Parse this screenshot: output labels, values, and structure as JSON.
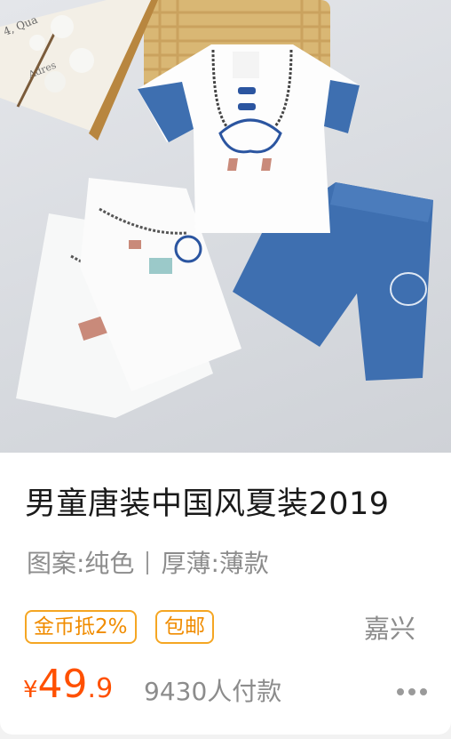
{
  "product": {
    "title": "男童唐装中国风夏装2019",
    "specs": [
      {
        "text": "图案:纯色"
      },
      {
        "text": "厚薄:薄款"
      }
    ],
    "badges": {
      "coin": "金币抵2%",
      "shipping": "包邮"
    },
    "location": "嘉兴",
    "price": {
      "currency": "¥",
      "integer": "49",
      "decimal": ".9"
    },
    "sales": "9430人付款",
    "book_text": {
      "line1": "4, Qua",
      "line2": "Adres"
    }
  },
  "colors": {
    "price": "#ff5000",
    "badge": "#f5a623",
    "secondary_text": "#8c8c8c",
    "title_text": "#1a1a1a"
  },
  "icons": {
    "more": "more-dots-icon"
  }
}
